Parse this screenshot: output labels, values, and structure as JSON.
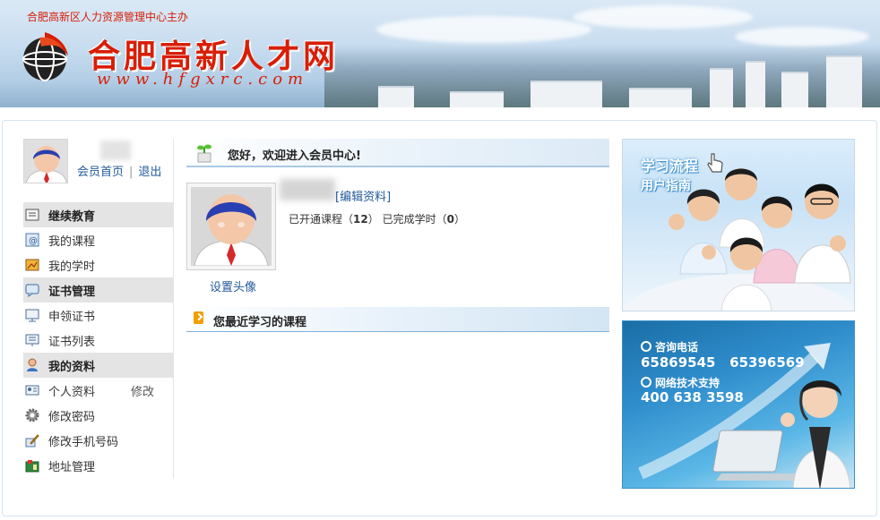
{
  "banner": {
    "host": "合肥高新区人力资源管理中心主办",
    "logo_text": "合肥高新人才网",
    "logo_url": "www.hfgxrc.com"
  },
  "sidebar": {
    "user_links": {
      "home": "会员首页",
      "sep": "|",
      "logout": "退出"
    },
    "menu": [
      {
        "label": "继续教育",
        "section": true,
        "icon": "education-icon"
      },
      {
        "label": "我的课程",
        "section": false,
        "icon": "course-icon"
      },
      {
        "label": "我的学时",
        "section": false,
        "icon": "hours-icon"
      },
      {
        "label": "证书管理",
        "section": true,
        "icon": "certificate-manage-icon"
      },
      {
        "label": "申领证书",
        "section": false,
        "icon": "apply-certificate-icon"
      },
      {
        "label": "证书列表",
        "section": false,
        "icon": "certificate-list-icon"
      },
      {
        "label": "我的资料",
        "section": true,
        "icon": "profile-icon"
      },
      {
        "label": "个人资料",
        "section": false,
        "icon": "personal-info-icon",
        "extra": "修改"
      },
      {
        "label": "修改密码",
        "section": false,
        "icon": "gear-icon"
      },
      {
        "label": "修改手机号码",
        "section": false,
        "icon": "pencil-icon"
      },
      {
        "label": "地址管理",
        "section": false,
        "icon": "address-icon"
      }
    ]
  },
  "main": {
    "welcome": "您好，欢迎进入会员中心!",
    "edit_profile": "[编辑资料]",
    "set_avatar": "设置头像",
    "stats": {
      "courses_label": "已开通课程（",
      "courses_value": "12",
      "courses_end": "）",
      "hours_label": "已完成学时（",
      "hours_value": "0",
      "hours_end": "）"
    },
    "recent_title": "您最近学习的课程"
  },
  "ads": {
    "ad1": {
      "line1": "学习流程",
      "line2": "用户指南"
    },
    "ad2": {
      "consult_label": "咨询电话",
      "consult_numbers": "65869545   65396569",
      "support_label": "网络技术支持",
      "support_number": "400 638 3598"
    }
  }
}
